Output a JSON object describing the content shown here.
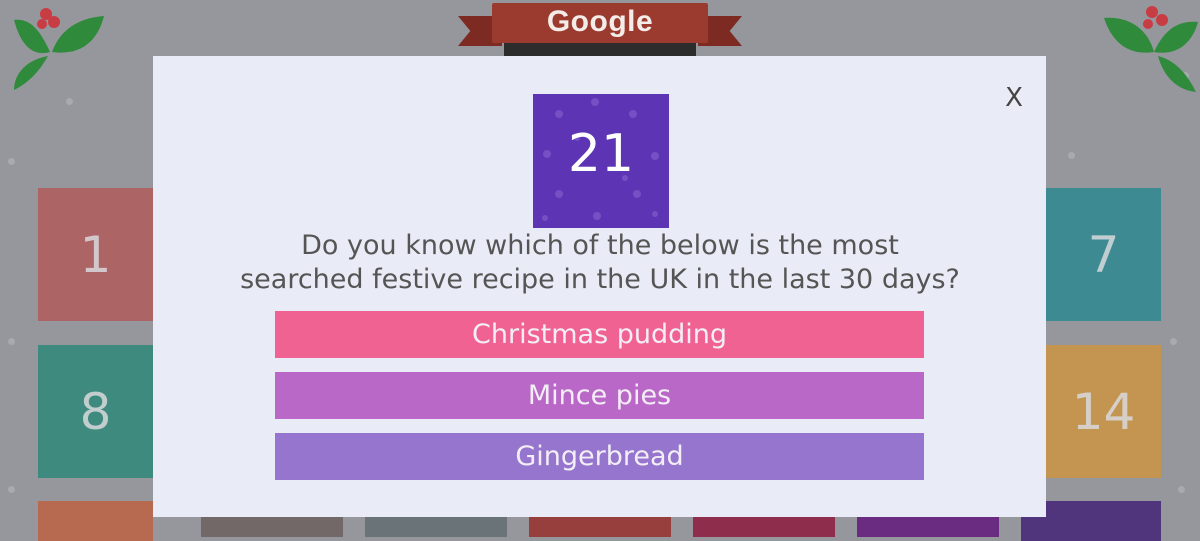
{
  "header": {
    "title": "Google"
  },
  "modal": {
    "day_number": "21",
    "question": "Do you know which of the below is the most searched festive recipe in the UK in the last 30 days?",
    "answers": [
      {
        "label": "Christmas pudding",
        "color": "#f06292"
      },
      {
        "label": "Mince pies",
        "color": "#ba68c8"
      },
      {
        "label": "Gingerbread",
        "color": "#9575cd"
      }
    ],
    "close_label": "X",
    "day_tile_color": "#5c34b4"
  },
  "calendar": {
    "tiles": [
      {
        "label": "1",
        "color": "#ad6464"
      },
      {
        "label": "7",
        "color": "#3d8a92"
      },
      {
        "label": "8",
        "color": "#3f8a7e"
      },
      {
        "label": "14",
        "color": "#c49550"
      }
    ],
    "bottom_row_colors": [
      "#b86a50",
      "#726868",
      "#6a7478",
      "#973f3c",
      "#8f2d4c",
      "#6a2c80",
      "#50357c"
    ]
  },
  "colors": {
    "background": "#95979c",
    "modal_background": "#e9ecf6",
    "banner": "#9b3b2f"
  }
}
